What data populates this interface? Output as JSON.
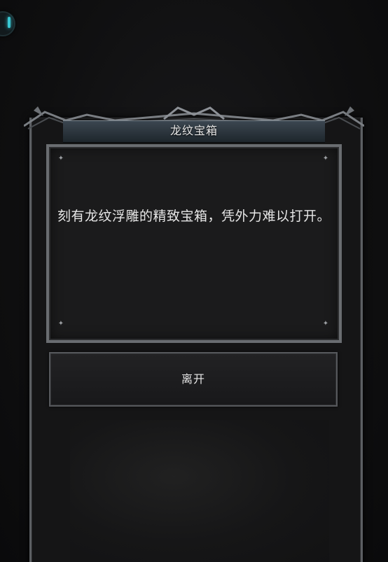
{
  "dialog": {
    "title": "龙纹宝箱",
    "description": "刻有龙纹浮雕的精致宝箱，凭外力难以打开。",
    "leave_label": "离开"
  },
  "corner_badge": {
    "icon": "status-badge-icon",
    "accent_color": "#39c6d2"
  },
  "colors": {
    "background": "#0e0e0f",
    "frame": "#6a6d71",
    "title_bar": "#3b4650",
    "text": "#e6e6e6"
  }
}
